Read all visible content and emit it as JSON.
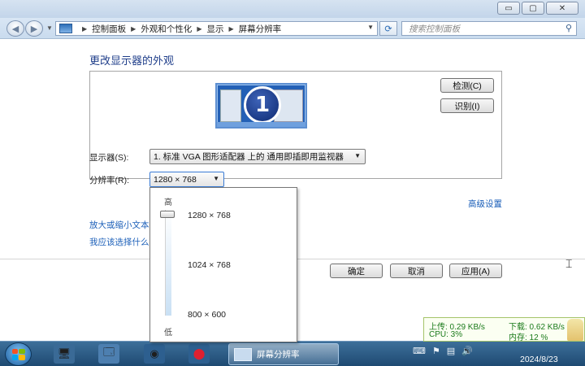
{
  "window": {
    "minimize": "▭",
    "maximize": "▢",
    "close": "✕"
  },
  "nav": {
    "back_icon": "back-arrow-icon",
    "forward_icon": "forward-arrow-icon",
    "breadcrumbs": [
      "控制面板",
      "外观和个性化",
      "显示",
      "屏幕分辨率"
    ],
    "search_placeholder": "搜索控制面板"
  },
  "content": {
    "heading": "更改显示器的外观",
    "monitor_number": "1",
    "detect_button": "检测(C)",
    "identify_button": "识别(I)",
    "display_label": "显示器(S):",
    "display_value": "1. 标准 VGA 图形适配器 上的 通用即插即用监视器",
    "resolution_label": "分辨率(R):",
    "resolution_value": "1280 × 768",
    "advanced_link": "高级设置",
    "enlarge_link": "放大或缩小文本",
    "which_link": "我应该选择什么",
    "ok_button": "确定",
    "cancel_button": "取消",
    "apply_button": "应用(A)"
  },
  "resolution_dropdown": {
    "high_label": "高",
    "low_label": "低",
    "options": [
      "1280 × 768",
      "1024 × 768",
      "800 × 600"
    ],
    "selected_index": 0
  },
  "network_monitor": {
    "upload": "上传: 0.29 KB/s",
    "download": "下载: 0.62 KB/s",
    "cpu": "CPU: 3%",
    "memory": "内存: 12 %"
  },
  "taskbar": {
    "active_task": "屏幕分辨率",
    "date": "2024/8/23"
  }
}
